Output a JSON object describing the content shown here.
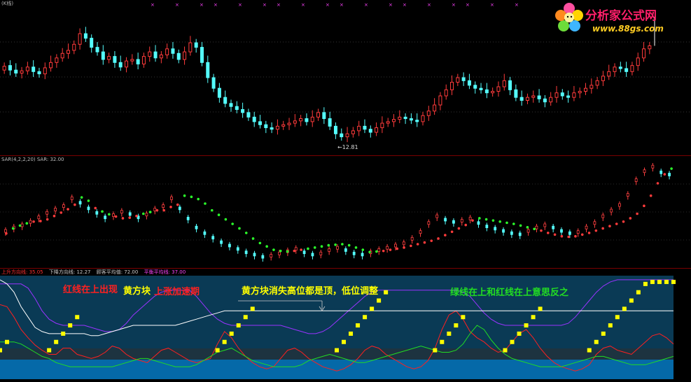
{
  "logo": {
    "name": "分析家公式网",
    "url": "www.88gs.com"
  },
  "pane1": {
    "header": "(K线)",
    "low_label": "←12.81"
  },
  "pane2": {
    "header": "SAR(4,2,2,20)  SAR: 32.00"
  },
  "pane3": {
    "header_items": [
      {
        "text": "上升方向线: 35.05",
        "color": "#ff3030"
      },
      {
        "text": "下降方向线: 12.27",
        "color": "#cccccc"
      },
      {
        "text": "顾客平均值: 72.00",
        "color": "#cccccc"
      },
      {
        "text": "平衡平均线: 37.00",
        "color": "#ff44ff"
      }
    ],
    "annotations": [
      {
        "text": "红线在上出现",
        "color": "#ff2020"
      },
      {
        "text": "黄方块",
        "color": "#ffff00"
      },
      {
        "text": "上涨加速期",
        "color": "#ff2020"
      },
      {
        "text": "黄方块消失高位都是顶，低位调整",
        "color": "#ffff00"
      },
      {
        "text": "绿线在上和红线在上意思反之",
        "color": "#22dd22"
      }
    ]
  },
  "chart_data": [
    {
      "type": "candlestick",
      "title": "",
      "y_low_label": 12.81,
      "closes": [
        22.5,
        22.0,
        21.6,
        21.9,
        22.4,
        21.8,
        21.5,
        22.3,
        23.0,
        23.6,
        24.2,
        24.6,
        25.4,
        26.8,
        26.2,
        25.0,
        24.4,
        23.4,
        23.8,
        23.0,
        22.4,
        23.2,
        23.4,
        22.8,
        23.8,
        24.4,
        23.6,
        24.0,
        24.8,
        24.2,
        23.4,
        24.4,
        25.6,
        25.0,
        23.0,
        21.0,
        19.6,
        18.4,
        17.6,
        17.2,
        16.8,
        16.4,
        15.8,
        15.2,
        14.8,
        14.4,
        14.2,
        14.6,
        14.8,
        15.0,
        15.3,
        15.6,
        15.2,
        15.8,
        16.4,
        15.6,
        14.6,
        13.6,
        13.2,
        13.6,
        14.0,
        14.6,
        14.2,
        13.8,
        14.4,
        15.0,
        15.2,
        15.5,
        15.8,
        15.6,
        15.4,
        15.2,
        16.0,
        16.6,
        17.4,
        18.6,
        19.4,
        20.4,
        21.0,
        20.6,
        20.0,
        19.6,
        19.4,
        19.0,
        19.2,
        19.8,
        20.6,
        19.4,
        18.4,
        18.0,
        18.4,
        18.6,
        18.2,
        17.8,
        18.4,
        19.0,
        18.6,
        18.4,
        19.0,
        19.2,
        19.6,
        20.0,
        20.6,
        21.2,
        21.8,
        22.4,
        22.2,
        21.8,
        22.6,
        23.6,
        24.8,
        25.2
      ],
      "opens": [
        22.0,
        22.6,
        22.0,
        21.6,
        21.9,
        22.4,
        21.8,
        21.5,
        22.3,
        23.0,
        23.6,
        24.2,
        24.6,
        25.4,
        26.8,
        26.2,
        25.0,
        24.4,
        23.4,
        23.8,
        23.0,
        22.4,
        23.2,
        23.4,
        22.8,
        23.8,
        24.4,
        23.6,
        24.0,
        24.8,
        24.2,
        23.4,
        24.4,
        25.6,
        25.0,
        23.0,
        21.0,
        19.6,
        18.4,
        17.6,
        17.2,
        16.8,
        16.4,
        15.8,
        15.2,
        14.8,
        14.4,
        14.2,
        14.6,
        14.8,
        15.0,
        15.3,
        15.6,
        15.2,
        15.8,
        16.4,
        15.6,
        14.6,
        13.6,
        13.2,
        13.6,
        14.0,
        14.6,
        14.2,
        13.8,
        14.4,
        15.0,
        15.2,
        15.5,
        15.8,
        15.6,
        15.4,
        15.2,
        16.0,
        16.6,
        17.4,
        18.6,
        19.4,
        20.4,
        21.0,
        20.6,
        20.0,
        19.6,
        19.4,
        19.0,
        19.2,
        19.8,
        20.6,
        19.4,
        18.4,
        18.0,
        18.4,
        18.6,
        18.2,
        17.8,
        18.4,
        19.0,
        18.6,
        18.4,
        19.0,
        19.2,
        19.6,
        20.0,
        20.6,
        21.2,
        21.8,
        22.4,
        22.2,
        21.8,
        22.6,
        23.6,
        24.8
      ],
      "ylim": [
        11.5,
        30.5
      ],
      "last_high": 29.0
    },
    {
      "type": "line",
      "title": "SAR(4,2,2,20)",
      "series": [
        {
          "name": "SAR",
          "values": [
            20.5,
            21.4,
            21.9,
            22.3,
            22.6,
            22.7,
            23.0,
            23.6,
            24.2,
            24.8,
            25.6,
            26.9,
            26.3,
            25.0,
            24.4,
            23.9,
            23.5,
            23.2,
            23.3,
            23.6,
            24.0,
            24.3,
            24.6,
            24.6,
            25.2,
            25.6,
            27.2,
            27.0,
            26.6,
            25.8,
            24.6,
            23.8,
            23.0,
            22.2,
            21.4,
            20.6,
            19.6,
            18.8,
            18.2,
            17.6,
            17.4,
            17.3,
            17.4,
            17.6,
            17.8,
            18.0,
            18.2,
            18.4,
            18.5,
            18.6,
            18.4,
            18.0,
            17.6,
            17.2,
            17.3,
            17.4,
            17.6,
            17.8,
            18.0,
            18.3,
            18.6,
            18.9,
            19.2,
            19.6,
            20.2,
            20.8,
            21.4,
            22.0,
            22.8,
            23.2,
            23.0,
            22.8,
            22.6,
            22.4,
            22.2,
            21.9,
            21.6,
            21.3,
            21.0,
            20.6,
            20.3,
            20.0,
            19.9,
            20.0,
            20.3,
            20.6,
            21.0,
            21.4,
            21.8,
            22.2,
            22.6,
            23.2,
            24.0,
            25.4,
            27.2,
            29.4,
            31.0,
            32.0
          ]
        },
        {
          "name": "SAR-price",
          "values": [
            21.0,
            21.6,
            22.0,
            22.6,
            23.4,
            24.2,
            24.8,
            25.4,
            26.8,
            26.0,
            25.0,
            24.2,
            23.4,
            23.8,
            24.4,
            24.0,
            23.4,
            23.9,
            24.8,
            25.4,
            26.8,
            25.0,
            23.2,
            21.6,
            20.6,
            19.8,
            19.0,
            18.4,
            17.8,
            17.2,
            16.8,
            16.4,
            16.6,
            17.0,
            17.4,
            17.8,
            17.2,
            16.8,
            17.0,
            17.6,
            18.0,
            17.6,
            17.0,
            16.8,
            17.2,
            17.6,
            18.0,
            18.4,
            18.8,
            19.6,
            20.8,
            22.4,
            23.6,
            23.0,
            22.6,
            22.8,
            23.2,
            22.4,
            21.8,
            21.4,
            21.0,
            20.6,
            20.4,
            21.0,
            21.6,
            22.0,
            21.6,
            21.0,
            20.6,
            20.8,
            21.6,
            22.4,
            23.6,
            24.6,
            25.6,
            27.4,
            30.0,
            31.6,
            32.4,
            31.4,
            31.0
          ]
        }
      ]
    },
    {
      "type": "line",
      "title": "",
      "series": [
        {
          "name": "上升方向线",
          "values": [
            72,
            70,
            60,
            48,
            40,
            33,
            28,
            24,
            24,
            30,
            30,
            24,
            22,
            20,
            22,
            26,
            32,
            30,
            24,
            20,
            18,
            16,
            22,
            28,
            30,
            26,
            22,
            18,
            16,
            18,
            20,
            34,
            46,
            40,
            30,
            22,
            16,
            12,
            10,
            12,
            20,
            28,
            30,
            26,
            20,
            16,
            12,
            10,
            8,
            10,
            14,
            20,
            28,
            32,
            30,
            24,
            20,
            16,
            12,
            10,
            12,
            18,
            30,
            48,
            62,
            66,
            58,
            46,
            40,
            36,
            30,
            26,
            28,
            36,
            44,
            48,
            40,
            30,
            22,
            16,
            12,
            10,
            8,
            10,
            14,
            24,
            30,
            32,
            28,
            26,
            24,
            30,
            36,
            42,
            44,
            40,
            34
          ]
        },
        {
          "name": "下降方向线",
          "values": [
            36,
            36,
            36,
            34,
            30,
            26,
            22,
            20,
            16,
            14,
            12,
            12,
            12,
            12,
            12,
            12,
            12,
            14,
            16,
            18,
            20,
            20,
            18,
            16,
            14,
            12,
            12,
            12,
            14,
            18,
            22,
            26,
            28,
            30,
            26,
            22,
            18,
            16,
            14,
            12,
            12,
            12,
            12,
            14,
            18,
            20,
            22,
            24,
            22,
            20,
            18,
            16,
            16,
            18,
            20,
            22,
            24,
            26,
            28,
            30,
            32,
            30,
            28,
            26,
            26,
            28,
            34,
            44,
            52,
            48,
            38,
            30,
            24,
            20,
            18,
            16,
            14,
            12,
            12,
            12,
            12,
            14,
            16,
            18,
            20,
            22,
            22,
            20,
            18,
            16,
            14,
            14,
            14,
            16,
            18,
            20,
            22
          ]
        },
        {
          "name": "顾客平均值",
          "values": [
            96,
            92,
            84,
            70,
            60,
            50,
            46,
            44,
            44,
            44,
            44,
            44,
            44,
            42,
            42,
            44,
            46,
            48,
            50,
            52,
            52,
            52,
            52,
            52,
            52,
            52,
            54,
            56,
            58,
            60,
            62,
            64,
            66,
            66,
            66,
            66,
            66,
            66,
            66,
            66,
            66,
            66,
            66,
            66,
            66,
            66,
            66,
            66,
            66,
            66,
            66,
            66,
            66,
            66,
            66,
            66,
            66,
            66,
            66,
            66,
            66,
            66,
            66,
            66,
            66,
            66,
            66,
            66,
            66,
            66,
            66,
            66,
            66,
            66,
            66,
            66,
            66,
            66,
            66,
            66,
            66,
            66,
            66,
            66,
            66,
            66,
            66,
            66,
            66,
            66,
            66,
            66,
            66,
            66,
            66,
            66,
            66
          ]
        },
        {
          "name": "平衡平均线",
          "values": [
            92,
            92,
            92,
            92,
            88,
            78,
            66,
            58,
            54,
            52,
            52,
            52,
            52,
            50,
            48,
            46,
            46,
            48,
            54,
            62,
            68,
            74,
            80,
            84,
            86,
            86,
            86,
            86,
            80,
            72,
            64,
            58,
            54,
            52,
            52,
            52,
            52,
            52,
            52,
            52,
            52,
            50,
            48,
            46,
            44,
            44,
            46,
            50,
            56,
            62,
            68,
            74,
            80,
            84,
            86,
            86,
            86,
            86,
            86,
            86,
            86,
            86,
            86,
            86,
            86,
            86,
            84,
            80,
            72,
            64,
            58,
            54,
            52,
            52,
            52,
            52,
            52,
            52,
            52,
            52,
            52,
            54,
            60,
            68,
            76,
            84,
            90,
            94,
            96,
            96,
            96,
            96,
            96,
            96,
            96,
            96,
            96
          ]
        }
      ]
    }
  ]
}
